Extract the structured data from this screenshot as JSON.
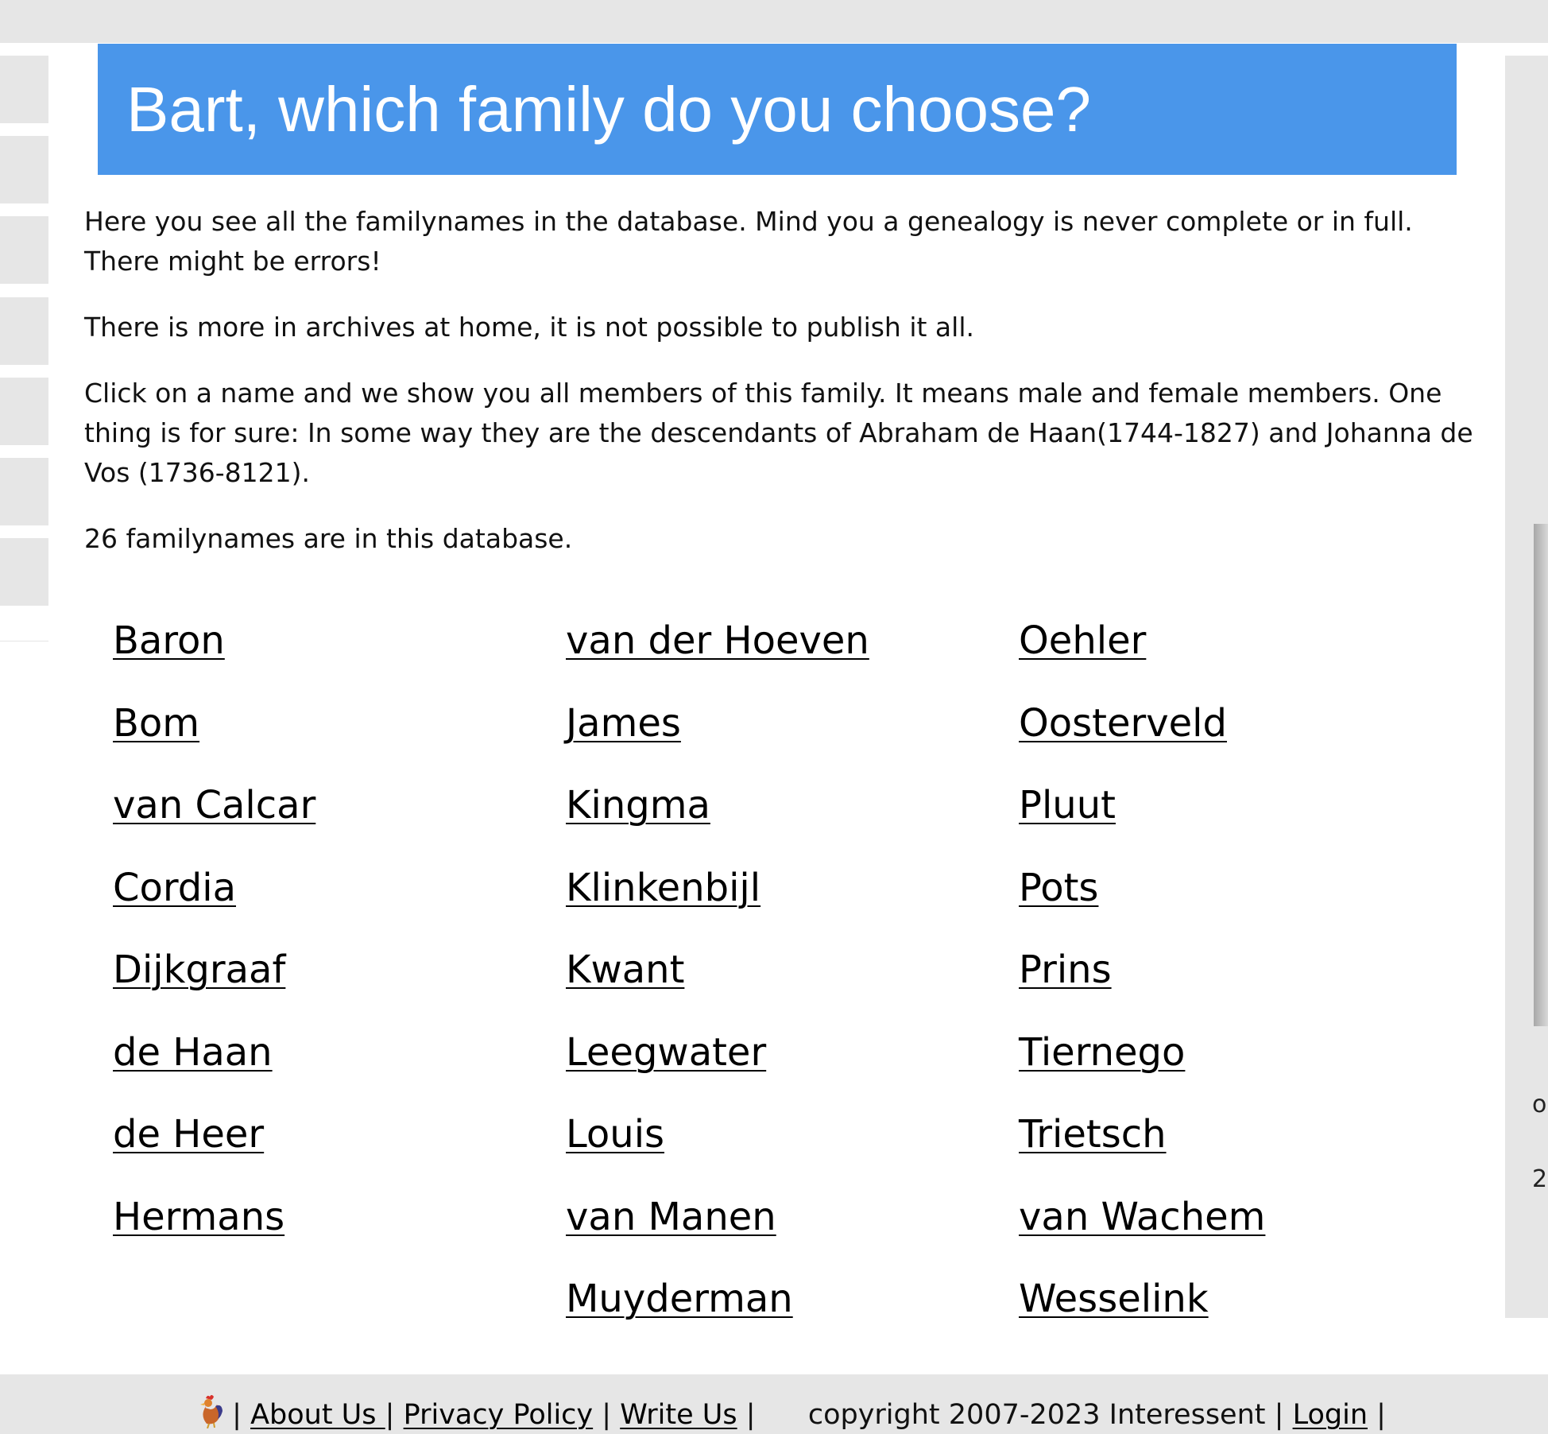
{
  "header": {
    "title": "Bart, which family do you choose?"
  },
  "intro": {
    "p1": "Here you see all the familynames in the database. Mind you a genealogy is never complete or in full. There might be errors!",
    "p2": "There is more in archives at home, it is not possible to publish it all.",
    "p3": "Click on a name and we show you all members of this family. It means male and female members. One thing is for sure: In some way they are the descendants of Abraham de Haan(1744-1827) and Johanna de Vos (1736-8121).",
    "count": "26 familynames are in this database."
  },
  "families": {
    "col1": [
      "Baron",
      "Bom",
      "van Calcar",
      "Cordia",
      "Dijkgraaf",
      "de Haan",
      "de Heer",
      "Hermans"
    ],
    "col2": [
      "van der Hoeven",
      "James",
      "Kingma",
      "Klinkenbijl",
      "Kwant",
      "Leegwater",
      "Louis",
      "van Manen",
      "Muyderman"
    ],
    "col3": [
      "Oehler",
      "Oosterveld",
      "Pluut",
      "Pots",
      "Prins",
      "Tiernego",
      "Trietsch",
      "van Wachem",
      "Wesselink"
    ]
  },
  "right_panel": {
    "fragment_1": "o",
    "fragment_2": "2"
  },
  "footer": {
    "logo_icon": "rooster-icon",
    "sep": "|",
    "about": "About Us ",
    "privacy": "Privacy Policy",
    "write": "Write Us",
    "copyright": "copyright 2007-2023 Interessent",
    "login": "Login"
  },
  "colors": {
    "banner": "#4a96ea",
    "background": "#e6e6e6",
    "content": "#ffffff"
  }
}
